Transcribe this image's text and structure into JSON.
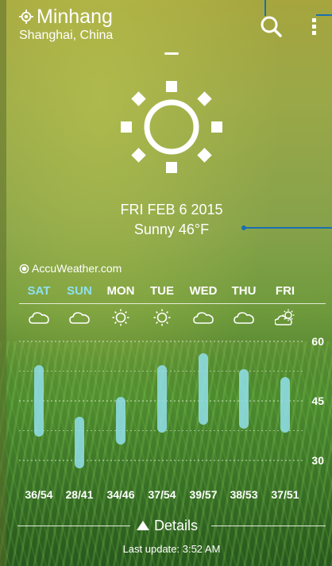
{
  "location": {
    "city": "Minhang",
    "region": "Shanghai, China"
  },
  "current": {
    "date": "FRI FEB 6 2015",
    "condition_text": "Sunny 46°F",
    "icon": "sun-icon"
  },
  "brand": {
    "name": "AccuWeather.com"
  },
  "toolbar": {
    "search_icon": "search-icon",
    "menu_icon": "more-vert-icon"
  },
  "colors": {
    "weekend_label": "#8fe0f0",
    "temp_bar": "#8fdde6",
    "annotation": "#1a6fb0",
    "text": "#ffffff"
  },
  "forecast": [
    {
      "day": "SAT",
      "weekend": true,
      "icon": "cloud-icon",
      "low": 36,
      "high": 54,
      "range": "36/54"
    },
    {
      "day": "SUN",
      "weekend": true,
      "icon": "cloud-icon",
      "low": 28,
      "high": 41,
      "range": "28/41"
    },
    {
      "day": "MON",
      "weekend": false,
      "icon": "sun-icon",
      "low": 34,
      "high": 46,
      "range": "34/46"
    },
    {
      "day": "TUE",
      "weekend": false,
      "icon": "sun-icon",
      "low": 37,
      "high": 54,
      "range": "37/54"
    },
    {
      "day": "WED",
      "weekend": false,
      "icon": "cloud-icon",
      "low": 39,
      "high": 57,
      "range": "39/57"
    },
    {
      "day": "THU",
      "weekend": false,
      "icon": "cloud-icon",
      "low": 38,
      "high": 53,
      "range": "38/53"
    },
    {
      "day": "FRI",
      "weekend": false,
      "icon": "partly-cloudy-icon",
      "low": 37,
      "high": 51,
      "range": "37/51"
    }
  ],
  "chart_data": {
    "type": "bar",
    "categories": [
      "SAT",
      "SUN",
      "MON",
      "TUE",
      "WED",
      "THU",
      "FRI"
    ],
    "series": [
      {
        "values": [
          36,
          28,
          34,
          37,
          39,
          38,
          37
        ]
      },
      {
        "values": [
          54,
          41,
          46,
          54,
          57,
          53,
          51
        ]
      }
    ],
    "ylim": [
      24,
      64
    ],
    "yticks": [
      "60",
      "45",
      "30"
    ],
    "grid": true
  },
  "details": {
    "label": "Details",
    "last_update": "Last update: 3:52 AM"
  }
}
